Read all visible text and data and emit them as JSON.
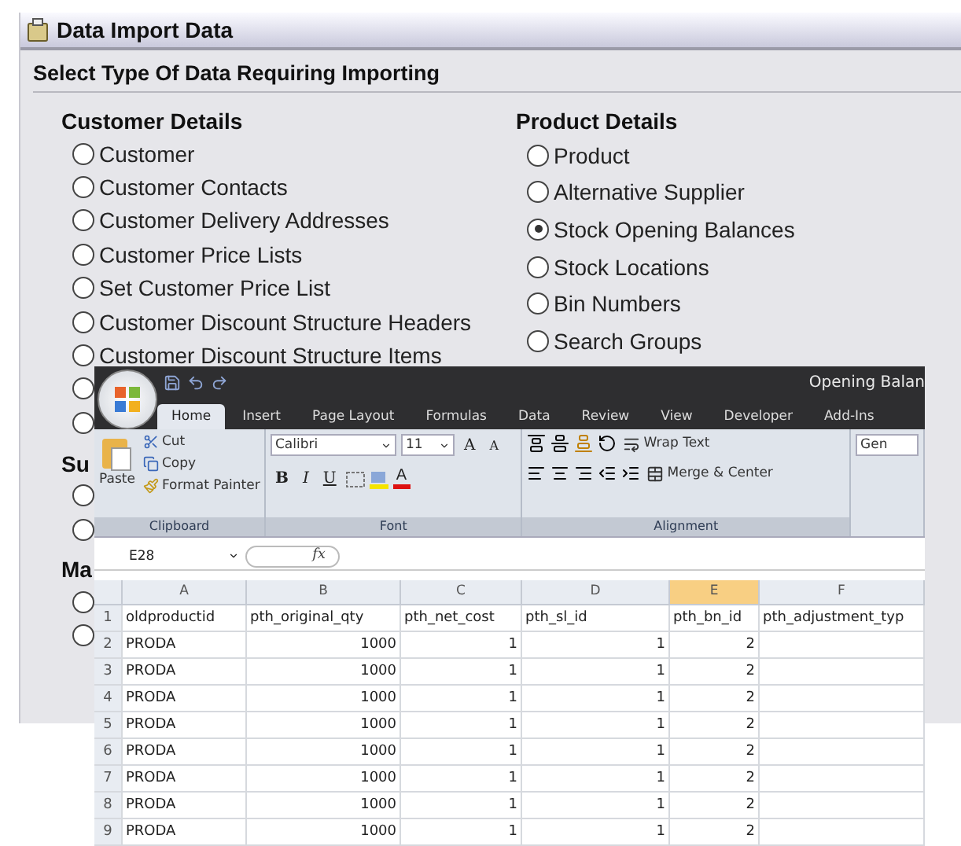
{
  "window": {
    "title": "Data Import Data"
  },
  "section_title": "Select Type Of Data Requiring Importing",
  "columns": [
    {
      "groups": [
        {
          "heading": "Customer Details",
          "options": [
            {
              "label": "Customer",
              "selected": false
            },
            {
              "label": "Customer Contacts",
              "selected": false
            },
            {
              "label": "Customer Delivery Addresses",
              "selected": false
            },
            {
              "label": "Customer Price Lists",
              "selected": false
            },
            {
              "label": "Set Customer Price List",
              "selected": false
            },
            {
              "label": "Customer Discount Structure Headers",
              "selected": false
            },
            {
              "label": "Customer Discount Structure Items",
              "selected": false
            },
            {
              "selected": false
            },
            {
              "selected": false
            }
          ]
        },
        {
          "heading": "Su",
          "options": [
            {
              "selected": false
            },
            {
              "selected": false
            }
          ]
        },
        {
          "heading": "Ma",
          "options": [
            {
              "selected": false
            },
            {
              "selected": false
            }
          ]
        }
      ]
    },
    {
      "groups": [
        {
          "heading": "Product Details",
          "options": [
            {
              "label": "Product",
              "selected": false
            },
            {
              "label": "Alternative Supplier",
              "selected": false
            },
            {
              "label": "Stock Opening Balances",
              "selected": true
            },
            {
              "label": "Stock Locations",
              "selected": false
            },
            {
              "label": "Bin Numbers",
              "selected": false
            },
            {
              "label": "Search Groups",
              "selected": false
            }
          ]
        }
      ]
    }
  ],
  "spreadsheet_window": {
    "title": "Opening Balan",
    "tabs": [
      {
        "label": "Home",
        "selected": true
      },
      {
        "label": "Insert",
        "selected": false
      },
      {
        "label": "Page Layout",
        "selected": false
      },
      {
        "label": "Formulas",
        "selected": false
      },
      {
        "label": "Data",
        "selected": false
      },
      {
        "label": "Review",
        "selected": false
      },
      {
        "label": "View",
        "selected": false
      },
      {
        "label": "Developer",
        "selected": false
      },
      {
        "label": "Add-Ins",
        "selected": false
      }
    ],
    "ribbon": {
      "clipboard": {
        "label": "Clipboard",
        "paste": "Paste",
        "cut": "Cut",
        "copy": "Copy",
        "format_painter": "Format Painter"
      },
      "font": {
        "label": "Font",
        "font_name": "Calibri",
        "font_size": "11",
        "grow": "A",
        "shrink": "A",
        "bold": "B",
        "italic": "I",
        "underline": "U",
        "text_color_button": "A"
      },
      "alignment": {
        "label": "Alignment",
        "wrap_text": "Wrap Text",
        "merge_center": "Merge & Center"
      },
      "number": {
        "format": "Gen"
      }
    },
    "name_box": "E28",
    "formula_label": "fx",
    "columns": [
      {
        "label": "A",
        "selected": false
      },
      {
        "label": "B",
        "selected": false
      },
      {
        "label": "C",
        "selected": false
      },
      {
        "label": "D",
        "selected": false
      },
      {
        "label": "E",
        "selected": true
      },
      {
        "label": "F",
        "selected": false
      }
    ],
    "rows": [
      {
        "number": "1",
        "cells": [
          "oldproductid",
          "pth_original_qty",
          "pth_net_cost",
          "pth_sl_id",
          "pth_bn_id",
          "pth_adjustment_typ"
        ]
      },
      {
        "number": "2",
        "cells": [
          "PRODA",
          "1000",
          "1",
          "1",
          "2",
          null
        ]
      },
      {
        "number": "3",
        "cells": [
          "PRODA",
          "1000",
          "1",
          "1",
          "2",
          null
        ]
      },
      {
        "number": "4",
        "cells": [
          "PRODA",
          "1000",
          "1",
          "1",
          "2",
          null
        ]
      },
      {
        "number": "5",
        "cells": [
          "PRODA",
          "1000",
          "1",
          "1",
          "2",
          null
        ]
      },
      {
        "number": "6",
        "cells": [
          "PRODA",
          "1000",
          "1",
          "1",
          "2",
          null
        ]
      },
      {
        "number": "7",
        "cells": [
          "PRODA",
          "1000",
          "1",
          "1",
          "2",
          null
        ]
      },
      {
        "number": "8",
        "cells": [
          "PRODA",
          "1000",
          "1",
          "1",
          "2",
          null
        ]
      },
      {
        "number": "9",
        "cells": [
          "PRODA",
          "1000",
          "1",
          "1",
          "2",
          null
        ]
      }
    ]
  }
}
